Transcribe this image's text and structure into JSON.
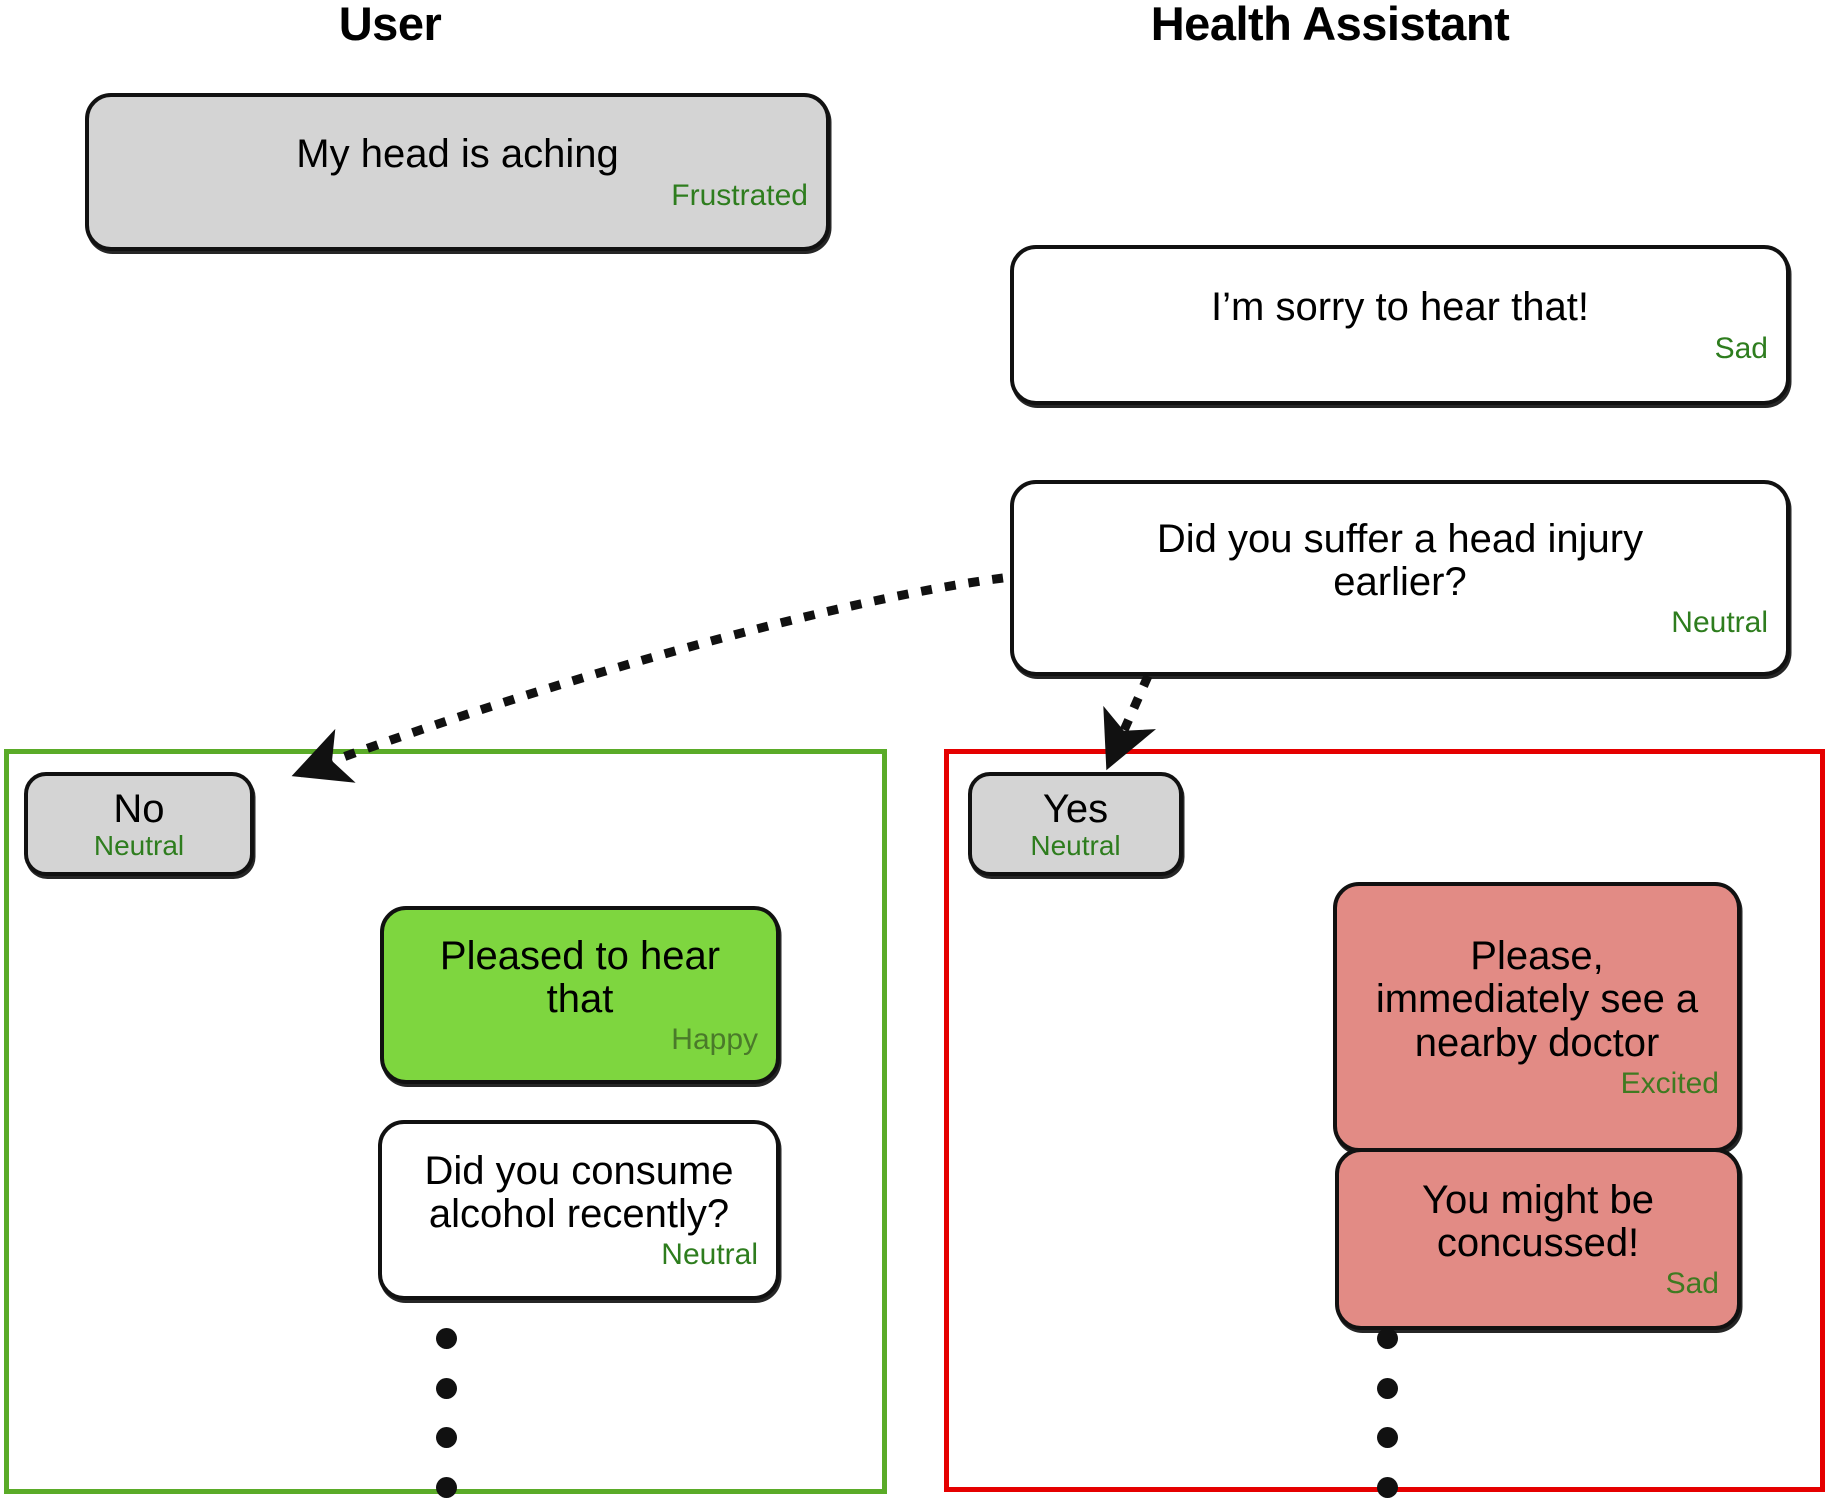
{
  "headers": {
    "user": "User",
    "assistant": "Health Assistant"
  },
  "colors": {
    "no_branch_border": "#5aab28",
    "yes_branch_border": "#e50000",
    "user_bubble_fill": "#d4d4d4",
    "assistant_bubble_fill": "#ffffff",
    "happy_bubble_fill": "#7ed63f",
    "alert_bubble_fill": "#e28b85",
    "emotion_label": "#2e7d1e",
    "bubble_stroke": "#111111"
  },
  "messages": {
    "head_aching": {
      "speaker": "user",
      "text": "My head is aching",
      "emotion": "Frustrated"
    },
    "sorry": {
      "speaker": "assistant",
      "text": "I’m sorry to hear that!",
      "emotion": "Sad"
    },
    "head_injury": {
      "speaker": "assistant",
      "text": "Did you suffer a head injury\nearlier?",
      "emotion": "Neutral"
    },
    "answer_no": {
      "speaker": "user",
      "text": "No",
      "emotion": "Neutral"
    },
    "answer_yes": {
      "speaker": "user",
      "text": "Yes",
      "emotion": "Neutral"
    },
    "pleased": {
      "speaker": "assistant",
      "text": "Pleased to hear\nthat",
      "emotion": "Happy"
    },
    "alcohol": {
      "speaker": "assistant",
      "text": "Did you consume\nalcohol recently?",
      "emotion": "Neutral"
    },
    "see_doctor": {
      "speaker": "assistant",
      "text": "Please,\nimmediately see a\nnearby doctor",
      "emotion": "Excited"
    },
    "concussed": {
      "speaker": "assistant",
      "text": "You might be\nconcussed!",
      "emotion": "Sad"
    }
  },
  "branches": {
    "no_branch": {
      "label": "No branch"
    },
    "yes_branch": {
      "label": "Yes branch"
    }
  },
  "ellipsis": {
    "left_dot_count": 4,
    "right_dot_count": 4
  }
}
